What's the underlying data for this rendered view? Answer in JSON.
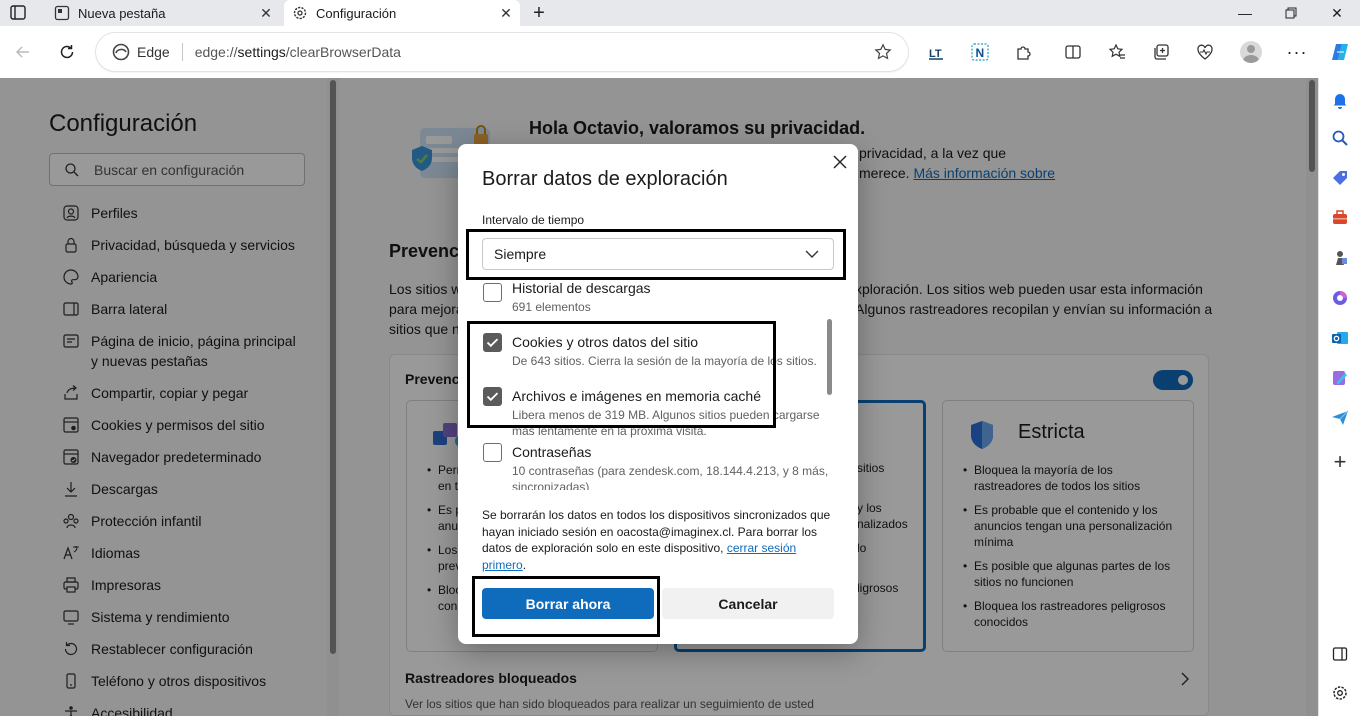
{
  "browser": {
    "tabs": [
      {
        "label": "Nueva pestaña"
      },
      {
        "label": "Configuración"
      }
    ],
    "address": {
      "prefix": "Edge",
      "url_scheme": "edge://",
      "url_host": "settings",
      "url_path": "/clearBrowserData"
    }
  },
  "settings": {
    "title": "Configuración",
    "search_placeholder": "Buscar en configuración",
    "nav": [
      {
        "label": "Perfiles",
        "icon": "profile-icon"
      },
      {
        "label": "Privacidad, búsqueda y servicios",
        "icon": "lock-icon"
      },
      {
        "label": "Apariencia",
        "icon": "palette-icon"
      },
      {
        "label": "Barra lateral",
        "icon": "sidebar-icon"
      },
      {
        "label": "Página de inicio, página principal",
        "label2": "y nuevas pestañas",
        "icon": "home-icon"
      },
      {
        "label": "Compartir, copiar y pegar",
        "icon": "share-icon"
      },
      {
        "label": "Cookies y permisos del sitio",
        "icon": "cookie-settings-icon"
      },
      {
        "label": "Navegador predeterminado",
        "icon": "browser-icon"
      },
      {
        "label": "Descargas",
        "icon": "download-icon"
      },
      {
        "label": "Protección infantil",
        "icon": "family-icon"
      },
      {
        "label": "Idiomas",
        "icon": "language-icon"
      },
      {
        "label": "Impresoras",
        "icon": "printer-icon"
      },
      {
        "label": "Sistema y rendimiento",
        "icon": "system-icon"
      },
      {
        "label": "Restablecer configuración",
        "icon": "reset-icon"
      },
      {
        "label": "Teléfono y otros dispositivos",
        "icon": "phone-icon"
      },
      {
        "label": "Accesibilidad",
        "icon": "accessibility-icon"
      }
    ],
    "privacy_header": "Hola Octavio, valoramos su privacidad.",
    "privacy_line1": "privacidad, a la vez que",
    "privacy_line2": "merece.",
    "privacy_link": "Más información sobre",
    "prevention_title": "Prevenc",
    "prevention_text1": "Los sitios w",
    "prevention_text1b": "xploración. Los sitios web pueden usar esta información",
    "prevention_text2": "para mejora",
    "prevention_text2b": "Algunos rastreadores recopilan y envían su información a",
    "prevention_text3": "sitios que n",
    "card_section_title": "Prevenci",
    "basic_bullets": [
      "Perr",
      "en t",
      "Es p",
      "anu",
      "Los",
      "prev",
      "Bloc",
      "con"
    ],
    "balanced_bullets": [
      "sitios",
      "y los",
      "nalizados",
      "lo",
      "ligrosos"
    ],
    "strict_title": "Estricta",
    "strict_bullets": [
      "Bloquea la mayoría de los",
      "rastreadores de todos los sitios",
      "Es probable que el contenido y los",
      "anuncios tengan una personalización",
      "mínima",
      "Es posible que algunas partes de los",
      "sitios no funcionen",
      "Bloquea los rastreadores peligrosos",
      "conocidos"
    ],
    "blocked_title": "Rastreadores bloqueados",
    "blocked_sub": "Ver los sitios que han sido bloqueados para realizar un seguimiento de usted"
  },
  "dialog": {
    "title": "Borrar datos de exploración",
    "range_label": "Intervalo de tiempo",
    "range_value": "Siempre",
    "items": [
      {
        "title": "Historial de descargas",
        "sub": "691 elementos",
        "checked": false
      },
      {
        "title": "Cookies y otros datos del sitio",
        "sub": "De 643 sitios. Cierra la sesión de la mayoría de los sitios.",
        "checked": true
      },
      {
        "title": "Archivos e imágenes en memoria caché",
        "sub": "Libera menos de 319 MB. Algunos sitios pueden cargarse",
        "sub2": "más lentamente en la próxima visita.",
        "checked": true
      },
      {
        "title": "Contraseñas",
        "sub": "10 contraseñas (para zendesk.com, 18.144.4.213, y 8 más,",
        "sub2": "sincronizadas)",
        "checked": false
      }
    ],
    "note1": "Se borrarán los datos en todos los dispositivos sincronizados que",
    "note2": "hayan iniciado sesión en oacosta@imaginex.cl. Para borrar los",
    "note3": "datos de exploración solo en este dispositivo,",
    "note_link1": "cerrar sesión",
    "note_link2": "primero",
    "note_end": ".",
    "primary_button": "Borrar ahora",
    "secondary_button": "Cancelar"
  },
  "colors": {
    "accent": "#0f6cbd",
    "highlight": "#000000"
  }
}
